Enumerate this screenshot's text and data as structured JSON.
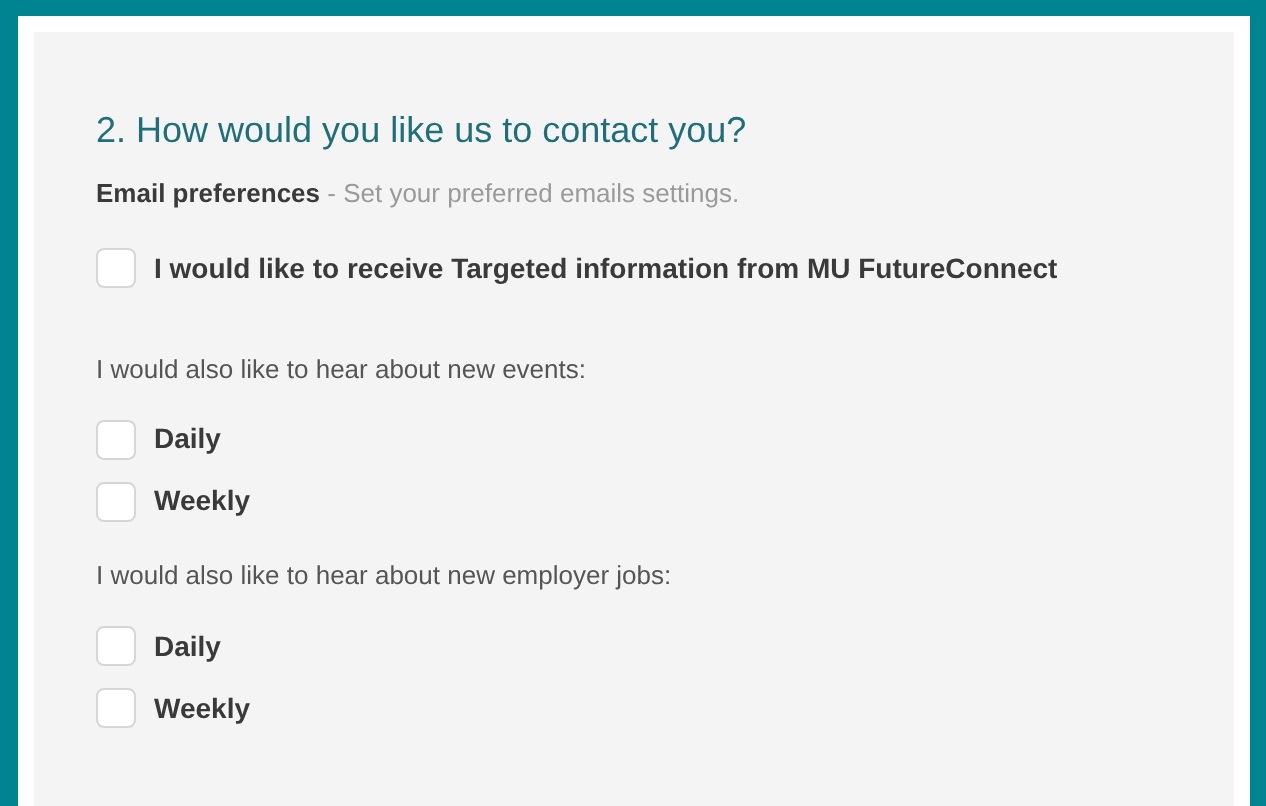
{
  "heading": "2. How would you like us to contact you?",
  "email_preferences": {
    "label": "Email preferences",
    "description": "- Set your preferred emails settings."
  },
  "targeted": {
    "label": "I would like to receive Targeted information from MU FutureConnect",
    "checked": false
  },
  "groups": [
    {
      "title": "I would also like to hear about new events:",
      "options": [
        {
          "label": "Daily",
          "checked": false
        },
        {
          "label": "Weekly",
          "checked": false
        }
      ]
    },
    {
      "title": "I would also like to hear about new employer jobs:",
      "options": [
        {
          "label": "Daily",
          "checked": false
        },
        {
          "label": "Weekly",
          "checked": false
        }
      ]
    }
  ]
}
